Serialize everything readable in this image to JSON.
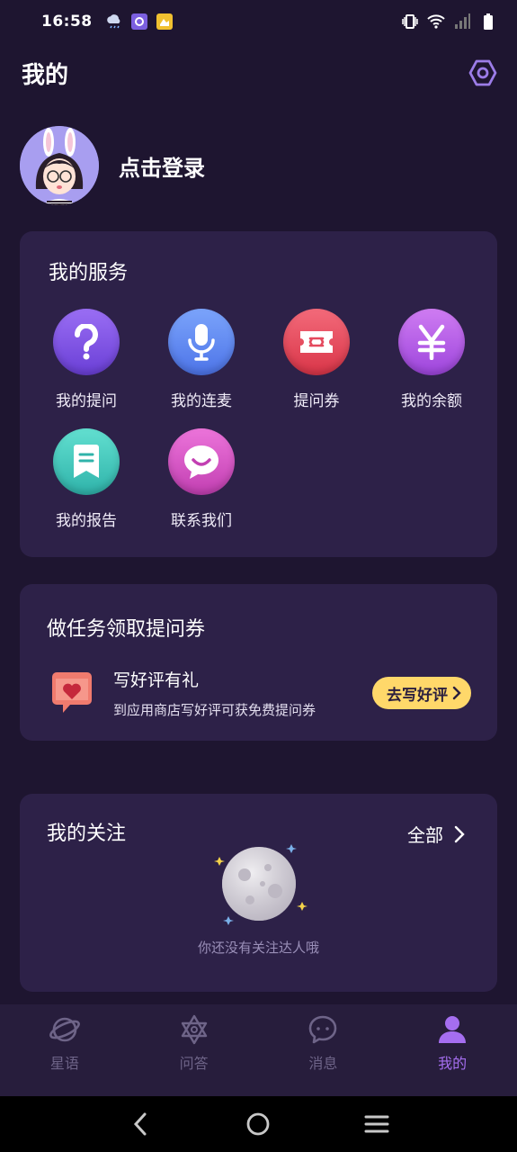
{
  "status": {
    "time": "16:58"
  },
  "header": {
    "title": "我的"
  },
  "profile": {
    "login_label": "点击登录"
  },
  "services": {
    "title": "我的服务",
    "items": [
      {
        "label": "我的提问",
        "icon": "question-icon",
        "color": "#7a4de0"
      },
      {
        "label": "我的连麦",
        "icon": "microphone-icon",
        "color": "#5b86f0"
      },
      {
        "label": "提问券",
        "icon": "ticket-icon",
        "color": "#e44a5e"
      },
      {
        "label": "我的余额",
        "icon": "yen-icon",
        "color": "#b45ce8"
      },
      {
        "label": "我的报告",
        "icon": "report-icon",
        "color": "#3ec9bd"
      },
      {
        "label": "联系我们",
        "icon": "chat-smile-icon",
        "color": "#d94fc6"
      }
    ]
  },
  "task": {
    "title": "做任务领取提问券",
    "name": "写好评有礼",
    "desc": "到应用商店写好评可获免费提问券",
    "button": "去写好评"
  },
  "follow": {
    "title": "我的关注",
    "all_label": "全部",
    "empty_text": "你还没有关注达人哦"
  },
  "tabs": [
    {
      "label": "星语",
      "icon": "planet-icon",
      "active": false
    },
    {
      "label": "问答",
      "icon": "hexagram-icon",
      "active": false
    },
    {
      "label": "消息",
      "icon": "message-icon",
      "active": false
    },
    {
      "label": "我的",
      "icon": "person-icon",
      "active": true
    }
  ],
  "colors": {
    "background": "#1e1530",
    "card": "#2d2148",
    "accent": "#a56ef0",
    "button": "#ffd86a"
  }
}
